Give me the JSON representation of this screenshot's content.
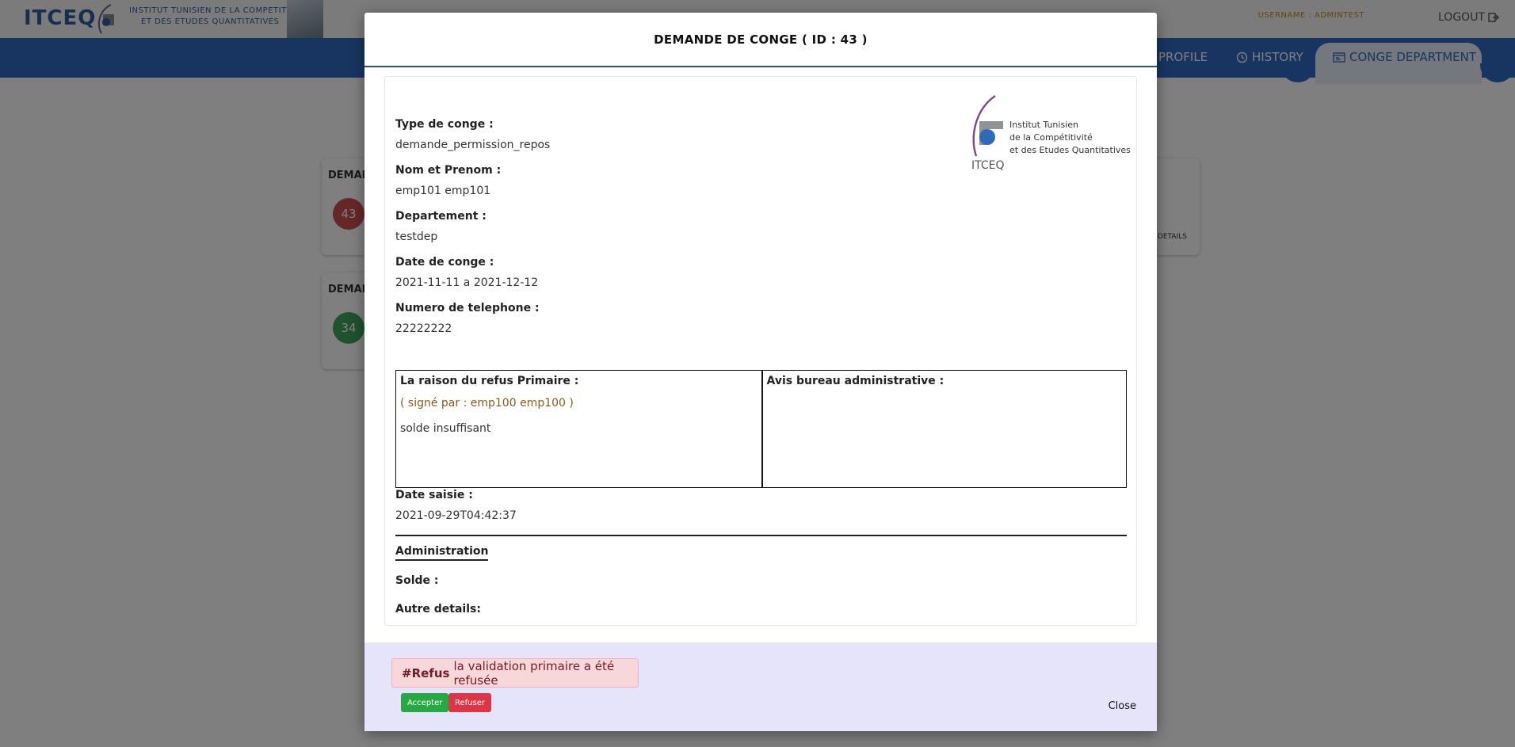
{
  "app": {
    "brand": "ITCEQ",
    "brand_line1": "INSTITUT TUNISIEN DE LA COMPETITIVITE",
    "brand_line2": "ET DES ETUDES QUANTITATIVES",
    "username": "USERNAME : ADMINTEST",
    "logout": "LOGOUT"
  },
  "nav": {
    "profile": "PROFILE",
    "history": "HISTORY",
    "conge_department": "CONGE DEPARTMENT"
  },
  "background_cards": [
    {
      "title": "DEMAN",
      "count": "43",
      "color": "#cf4f4f"
    },
    {
      "title": "DEMAN",
      "count": "34",
      "color": "#3fa55a"
    }
  ],
  "background_details": "DETAILS",
  "modal": {
    "title": "DEMANDE DE CONGE ( ID : 43 )",
    "logo": {
      "line1": "Institut Tunisien",
      "line2": "de la Compétitivité",
      "line3": "et des Etudes Quantitatives",
      "acronym": "ITCEQ"
    },
    "fields": {
      "type_label": "Type de conge :",
      "type_value": "demande_permission_repos",
      "name_label": "Nom et Prenom :",
      "name_value": "emp101 emp101",
      "dept_label": "Departement :",
      "dept_value": "testdep",
      "date_label": "Date de conge :",
      "date_value": "2021-11-11 a 2021-12-12",
      "phone_label": "Numero de telephone :",
      "phone_value": "22222222"
    },
    "refusal": {
      "label": "La raison du refus Primaire :",
      "signed": "( signé par : emp100 emp100 )",
      "text": "solde insuffisant"
    },
    "bureau": {
      "label": "Avis bureau administrative :"
    },
    "saisie": {
      "label": "Date saisie :",
      "value": "2021-09-29T04:42:37"
    },
    "administration": {
      "title": "Administration",
      "solde_label": "Solde :",
      "autre_label": "Autre details:"
    },
    "footer": {
      "alert_strong": "#Refus",
      "alert_text": "la validation primaire a été refusée",
      "accept": "Accepter",
      "refuse": "Refuser",
      "close": "Close"
    }
  },
  "colors": {
    "navbar": "#2f6ac0",
    "accept": "#28a745",
    "refuse": "#dc3545",
    "alert_bg": "#f8d7da",
    "footer_bg": "#e6e4fb"
  }
}
